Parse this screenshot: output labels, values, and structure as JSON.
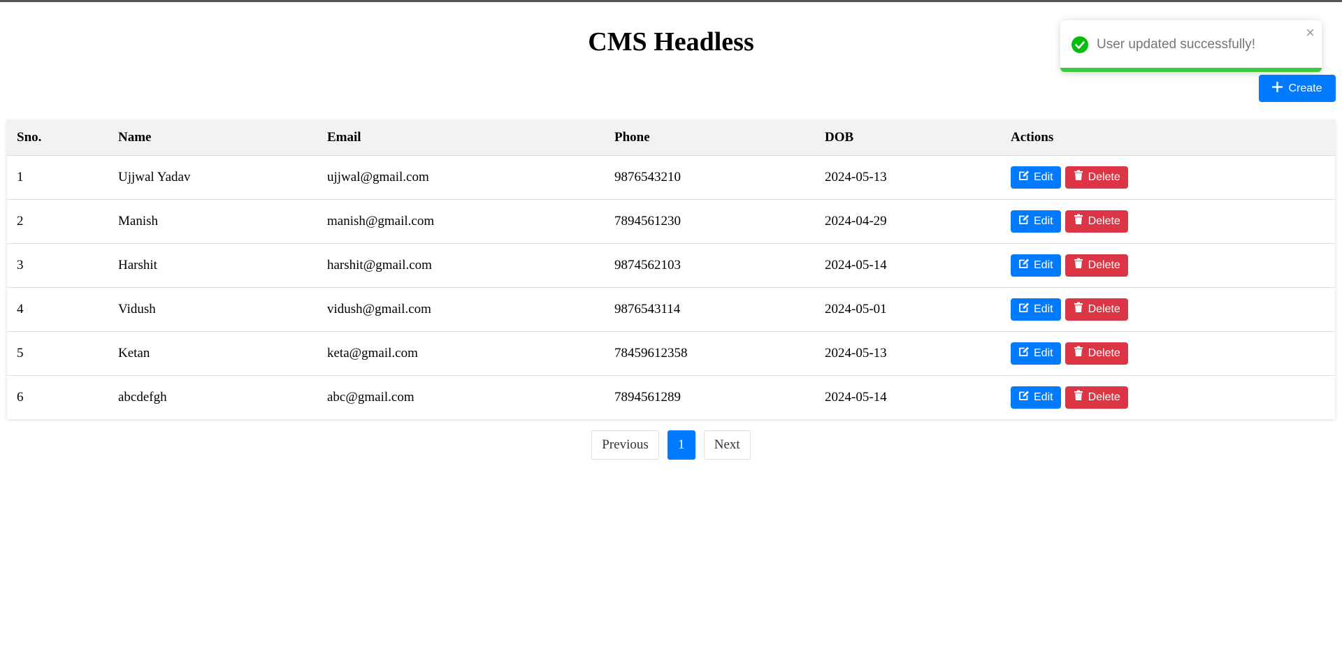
{
  "page": {
    "title": "CMS Headless"
  },
  "toolbar": {
    "create_label": "Create"
  },
  "toast": {
    "message": "User updated successfully!",
    "close_glyph": "×",
    "progress_fraction": 1.0
  },
  "table": {
    "headers": {
      "sno": "Sno.",
      "name": "Name",
      "email": "Email",
      "phone": "Phone",
      "dob": "DOB",
      "actions": "Actions"
    },
    "edit_label": "Edit",
    "delete_label": "Delete",
    "rows": [
      {
        "sno": "1",
        "name": "Ujjwal Yadav",
        "email": "ujjwal@gmail.com",
        "phone": "9876543210",
        "dob": "2024-05-13"
      },
      {
        "sno": "2",
        "name": "Manish",
        "email": "manish@gmail.com",
        "phone": "7894561230",
        "dob": "2024-04-29"
      },
      {
        "sno": "3",
        "name": "Harshit",
        "email": "harshit@gmail.com",
        "phone": "9874562103",
        "dob": "2024-05-14"
      },
      {
        "sno": "4",
        "name": "Vidush",
        "email": "vidush@gmail.com",
        "phone": "9876543114",
        "dob": "2024-05-01"
      },
      {
        "sno": "5",
        "name": "Ketan",
        "email": "keta@gmail.com",
        "phone": "78459612358",
        "dob": "2024-05-13"
      },
      {
        "sno": "6",
        "name": "abcdefgh",
        "email": "abc@gmail.com",
        "phone": "7894561289",
        "dob": "2024-05-14"
      }
    ]
  },
  "pagination": {
    "previous_label": "Previous",
    "current_page": "1",
    "next_label": "Next"
  },
  "colors": {
    "primary": "#007bff",
    "danger": "#dc3545",
    "success": "#3ec93e"
  },
  "icons": {
    "create": "plus-icon",
    "edit": "edit-icon",
    "delete": "trash-icon",
    "toast": "check-circle-icon",
    "toast_close": "close-icon"
  }
}
